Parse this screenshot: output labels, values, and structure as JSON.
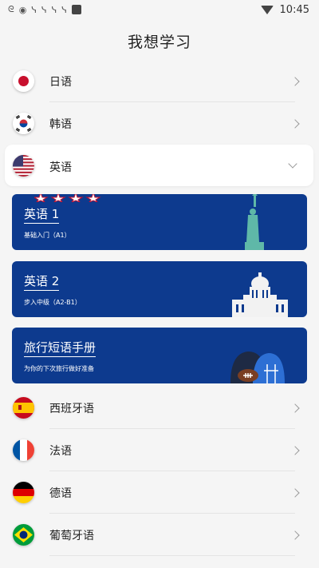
{
  "status_bar": {
    "time": "10:45"
  },
  "header": {
    "title": "我想学习"
  },
  "languages_top": [
    {
      "label": "日语",
      "flag": "japan"
    },
    {
      "label": "韩语",
      "flag": "korea"
    }
  ],
  "expanded": {
    "label": "英语",
    "flag": "usa"
  },
  "courses": [
    {
      "title": "英语 1",
      "subtitle": "基础入门（A1）",
      "art": "statue-of-liberty"
    },
    {
      "title": "英语 2",
      "subtitle": "步入中级（A2-B1）",
      "art": "capitol-building"
    },
    {
      "title": "旅行短语手册",
      "subtitle": "为你的下次旅行做好准备",
      "art": "football-helmet"
    }
  ],
  "languages_bottom": [
    {
      "label": "西班牙语",
      "flag": "spain"
    },
    {
      "label": "法语",
      "flag": "france"
    },
    {
      "label": "德语",
      "flag": "germany"
    },
    {
      "label": "葡萄牙语",
      "flag": "brazil"
    }
  ],
  "colors": {
    "card_bg": "#0d3a8e",
    "page_bg": "#f5f5f5"
  }
}
